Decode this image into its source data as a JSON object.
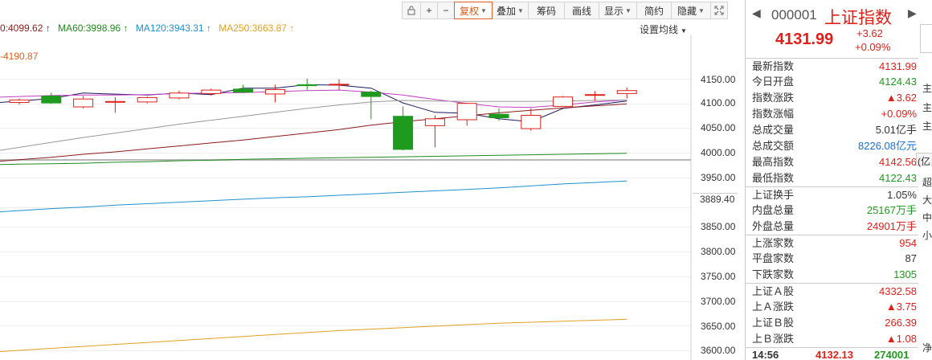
{
  "toolbar": {
    "items": [
      {
        "label": "",
        "icon": "lock-icon"
      },
      {
        "label": "+",
        "icon": "zoom-in-icon"
      },
      {
        "label": "−",
        "icon": "zoom-out-icon"
      },
      {
        "label": "复权",
        "dropdown": true,
        "active": true
      },
      {
        "label": "叠加",
        "dropdown": true
      },
      {
        "label": "筹码"
      },
      {
        "label": "画线"
      },
      {
        "label": "显示",
        "dropdown": true
      },
      {
        "label": "简约"
      },
      {
        "label": "隐藏",
        "dropdown": true
      },
      {
        "label": "",
        "icon": "fullscreen-icon"
      }
    ]
  },
  "ma_bar": {
    "ma30": "0:4099.62 ↑",
    "ma60": "MA60:3998.96 ↑",
    "ma120": "MA120:3943.31 ↑",
    "ma250": "MA250:3663.87 ↑",
    "setting_label": "设置均线"
  },
  "colors": {
    "ma5": "#1a1a5e",
    "ma10": "#c040c0",
    "ma20": "#999999",
    "ma30": "#8b1a1a",
    "ma60": "#1e8a1e",
    "ma120": "#2090d0",
    "ma250": "#e0a020",
    "up": "#e0201a",
    "down": "#1e9a1e"
  },
  "chart": {
    "high_label": "-4190.87",
    "current_price_label": "3889.40",
    "y_ticks": [
      "4150.00",
      "4100.00",
      "4050.00",
      "4000.00",
      "3950.00",
      "3850.00",
      "3800.00",
      "3750.00",
      "3700.00",
      "3650.00",
      "3600.00"
    ]
  },
  "chart_data": {
    "type": "candlestick",
    "y_range": [
      3600,
      4200
    ],
    "candles": [
      {
        "o": 4102,
        "c": 4107,
        "h": 4110,
        "l": 4098
      },
      {
        "o": 4115,
        "c": 4101,
        "h": 4122,
        "l": 4099
      },
      {
        "o": 4093,
        "c": 4109,
        "h": 4115,
        "l": 4090
      },
      {
        "o": 4103,
        "c": 4104,
        "h": 4113,
        "l": 4081
      },
      {
        "o": 4103,
        "c": 4112,
        "h": 4114,
        "l": 4100
      },
      {
        "o": 4111,
        "c": 4121,
        "h": 4126,
        "l": 4108
      },
      {
        "o": 4120,
        "c": 4127,
        "h": 4130,
        "l": 4116
      },
      {
        "o": 4129,
        "c": 4123,
        "h": 4138,
        "l": 4121
      },
      {
        "o": 4119,
        "c": 4128,
        "h": 4138,
        "l": 4102
      },
      {
        "o": 4138,
        "c": 4136,
        "h": 4150,
        "l": 4127
      },
      {
        "o": 4139,
        "c": 4139,
        "h": 4149,
        "l": 4127
      },
      {
        "o": 4123,
        "c": 4114,
        "h": 4126,
        "l": 4068
      },
      {
        "o": 4074,
        "c": 4007,
        "h": 4094,
        "l": 4005
      },
      {
        "o": 4055,
        "c": 4069,
        "h": 4076,
        "l": 4011
      },
      {
        "o": 4067,
        "c": 4100,
        "h": 4101,
        "l": 4055
      },
      {
        "o": 4078,
        "c": 4071,
        "h": 4090,
        "l": 4065
      },
      {
        "o": 4049,
        "c": 4076,
        "h": 4090,
        "l": 4045
      },
      {
        "o": 4094,
        "c": 4113,
        "h": 4115,
        "l": 4094
      },
      {
        "o": 4118,
        "c": 4118,
        "h": 4125,
        "l": 4105
      },
      {
        "o": 4120,
        "c": 4126,
        "h": 4132,
        "l": 4110
      }
    ],
    "ma_series": [
      {
        "key": "ma5",
        "values": [
          4105,
          4110,
          4121,
          4119,
          4117,
          4121,
          4118,
          4131,
          4131,
          4138,
          4137,
          4131,
          4101,
          4082,
          4080,
          4069,
          4063,
          4090,
          4097,
          4105
        ]
      },
      {
        "key": "ma10",
        "values": [
          4114,
          4116,
          4117,
          4117,
          4118,
          4120,
          4121,
          4122,
          4124,
          4126,
          4127,
          4123,
          4117,
          4108,
          4100,
          4093,
          4092,
          4097,
          4103,
          4107
        ]
      },
      {
        "key": "ma20",
        "values": [
          4011,
          4021,
          4031,
          4040,
          4049,
          4058,
          4066,
          4074,
          4082,
          4090,
          4097,
          4103,
          4106,
          4105,
          4104,
          4104,
          4104,
          4105,
          4106,
          4107
        ]
      },
      {
        "key": "ma30",
        "values": [
          3986,
          3991,
          3997,
          4002,
          4008,
          4014,
          4020,
          4026,
          4033,
          4040,
          4047,
          4056,
          4063,
          4069,
          4075,
          4081,
          4086,
          4091,
          4095,
          4099
        ]
      },
      {
        "key": "ma60",
        "values": [
          3977,
          3978,
          3979,
          3981,
          3982,
          3984,
          3985,
          3987,
          3988,
          3989,
          3990,
          3991,
          3992,
          3993,
          3994,
          3995,
          3996,
          3997,
          3998,
          3999
        ]
      },
      {
        "key": "ma120",
        "values": [
          3883,
          3887,
          3890,
          3894,
          3897,
          3900,
          3903,
          3906,
          3909,
          3911,
          3914,
          3917,
          3920,
          3923,
          3926,
          3929,
          3933,
          3937,
          3940,
          3943
        ]
      },
      {
        "key": "ma250",
        "values": [
          3600,
          3604,
          3608,
          3612,
          3616,
          3620,
          3624,
          3628,
          3632,
          3636,
          3640,
          3643,
          3646,
          3649,
          3652,
          3655,
          3657,
          3659,
          3661,
          3663
        ]
      }
    ]
  },
  "panel": {
    "code": "000001",
    "name": "上证指数",
    "price": "4131.99",
    "change_abs": "+3.62",
    "change_pct": "+0.09%",
    "stats": [
      {
        "label": "最新指数",
        "value": "4131.99",
        "color": "red"
      },
      {
        "label": "今日开盘",
        "value": "4124.43",
        "color": "green"
      },
      {
        "label": "指数涨跌",
        "value": "▲3.62",
        "color": "red"
      },
      {
        "label": "指数涨幅",
        "value": "+0.09%",
        "color": "red"
      },
      {
        "label": "总成交量",
        "value": "5.01亿手",
        "color": "dark"
      },
      {
        "label": "总成交额",
        "value": "8226.08亿元",
        "color": "blue"
      },
      {
        "label": "最高指数",
        "value": "4142.56",
        "color": "red"
      },
      {
        "label": "最低指数",
        "value": "4122.43",
        "color": "green",
        "sep_after": true
      },
      {
        "label": "上证换手",
        "value": "1.05%",
        "color": "dark"
      },
      {
        "label": "内盘总量",
        "value": "25167万手",
        "color": "green"
      },
      {
        "label": "外盘总量",
        "value": "24901万手",
        "color": "red",
        "sep_after": true
      },
      {
        "label": "上涨家数",
        "value": "954",
        "color": "red"
      },
      {
        "label": "平盘家数",
        "value": "87",
        "color": "dark"
      },
      {
        "label": "下跌家数",
        "value": "1305",
        "color": "green",
        "sep_after": true
      },
      {
        "label": "上证Ａ股",
        "value": "4332.58",
        "color": "red"
      },
      {
        "label": "上Ａ涨跌",
        "value": "▲3.75",
        "color": "red"
      },
      {
        "label": "上证Ｂ股",
        "value": "266.39",
        "color": "red"
      },
      {
        "label": "上Ｂ涨跌",
        "value": "▲1.08",
        "color": "red"
      }
    ],
    "tick": {
      "time": "14:56",
      "price": "4132.13",
      "volume": "274001"
    }
  },
  "side_strip": {
    "chars": [
      "主",
      "主",
      "主",
      "(亿",
      "超",
      "大",
      "中",
      "小",
      "净"
    ]
  }
}
